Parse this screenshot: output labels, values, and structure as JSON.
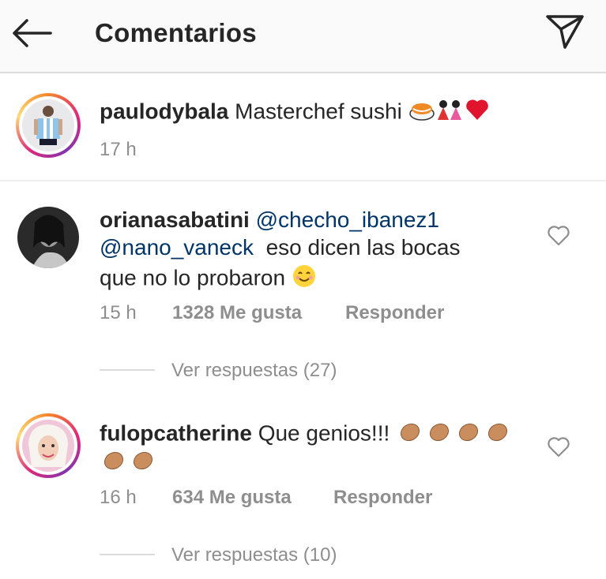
{
  "header": {
    "title": "Comentarios",
    "back_icon": "back-arrow-icon",
    "direct_icon": "paper-plane-icon"
  },
  "post": {
    "username": "paulodybala",
    "caption": "Masterchef sushi",
    "time": "17 h"
  },
  "comments": [
    {
      "username": "orianasabatini",
      "mention1": "@checho_ibanez1",
      "mention2": "@nano_vaneck",
      "text_line2": "eso dicen las bocas",
      "text_line3": "que no lo probaron",
      "time": "15 h",
      "likes": "1328 Me gusta",
      "reply": "Responder",
      "view_replies": "Ver respuestas (27)"
    },
    {
      "username": "fulopcatherine",
      "text": "Que genios!!!",
      "time": "16 h",
      "likes": "634 Me gusta",
      "reply": "Responder",
      "view_replies": "Ver respuestas (10)"
    }
  ],
  "colors": {
    "mention": "#003569",
    "secondary_text": "#8e8e8e",
    "story_ring": "#dd2a7b"
  }
}
